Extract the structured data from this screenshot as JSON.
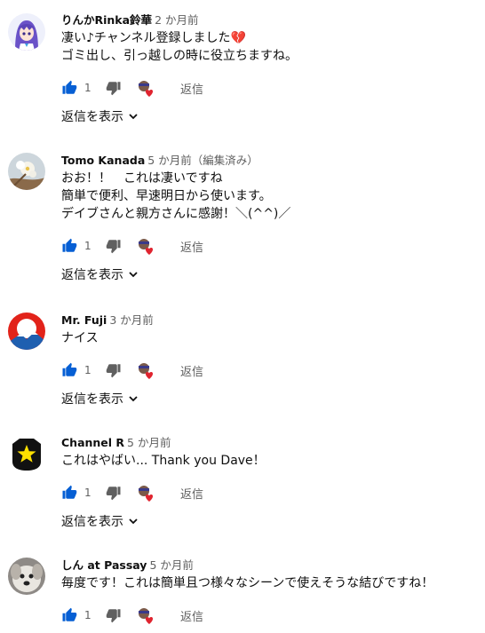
{
  "comments": [
    {
      "author": "りんかRinka鈴華",
      "time": "2 か月前",
      "text": "凄い♪チャンネル登録しました💔\nゴミ出し、引っ越しの時に役立ちますね。",
      "likes": "1",
      "reply_label": "返信",
      "replies_label": "返信を表示",
      "avatar_icon": "anime-avatar-icon"
    },
    {
      "author": "Tomo Kanada",
      "time": "5 か月前（編集済み）",
      "text": "おお！！　これは凄いですね\n簡単で便利、早速明日から使います。\nデイブさんと親方さんに感謝！＼(^^)／",
      "likes": "1",
      "reply_label": "返信",
      "replies_label": "返信を表示",
      "avatar_icon": "flower-avatar-icon"
    },
    {
      "author": "Mr. Fuji",
      "time": "3 か月前",
      "text": "ナイス",
      "likes": "1",
      "reply_label": "返信",
      "replies_label": "返信を表示",
      "avatar_icon": "mount-fuji-avatar-icon"
    },
    {
      "author": "Channel R",
      "time": "5 か月前",
      "text": "これはやばい... Thank you Dave！",
      "likes": "1",
      "reply_label": "返信",
      "replies_label": "返信を表示",
      "avatar_icon": "star-avatar-icon"
    },
    {
      "author": "しん at Passay",
      "time": "5 か月前",
      "text": "毎度です！これは簡単且つ様々なシーンで使えそうな結びですね！",
      "likes": "1",
      "reply_label": "返信",
      "avatar_icon": "dog-avatar-icon"
    }
  ],
  "colors": {
    "like_blue": "#065fd4",
    "secondary_text": "#606060",
    "heart_red": "#e0242f"
  }
}
